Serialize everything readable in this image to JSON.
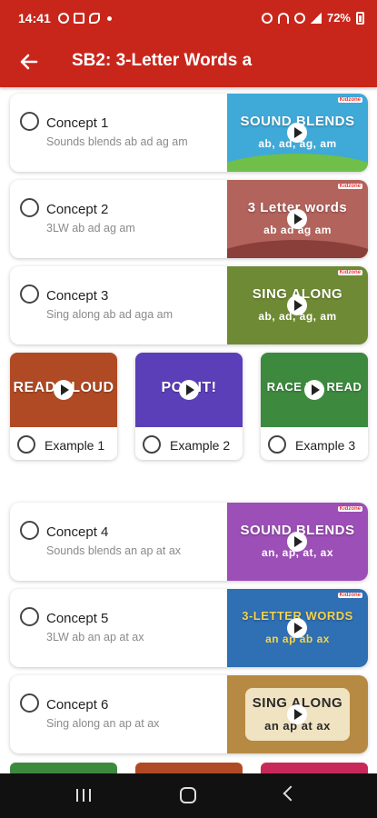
{
  "status": {
    "time": "14:41",
    "battery": "72%",
    "bar_color": "#c9261b"
  },
  "appbar": {
    "title": "SB2: 3-Letter Words a",
    "back_icon": "arrow-left-icon"
  },
  "concepts": [
    {
      "title": "Concept 1",
      "subtitle": "Sounds blends ab ad ag am",
      "thumb_line1": "SOUND BLENDS",
      "thumb_line2": "ab, ad, ag, am",
      "thumb_color": "#3fa9d8"
    },
    {
      "title": "Concept 2",
      "subtitle": "3LW ab ad ag am",
      "thumb_line1": "3 Letter words",
      "thumb_line2": "ab ad ag am",
      "thumb_color": "#b2635c"
    },
    {
      "title": "Concept 3",
      "subtitle": "Sing along ab ad aga am",
      "thumb_line1": "SING ALONG",
      "thumb_line2": "ab, ad, ag, am",
      "thumb_color": "#6f8a34"
    },
    {
      "title": "Concept 4",
      "subtitle": "Sounds blends an ap at ax",
      "thumb_line1": "SOUND BLENDS",
      "thumb_line2": "an, ap, at, ax",
      "thumb_color": "#9c4fb6"
    },
    {
      "title": "Concept 5",
      "subtitle": "3LW ab an ap at ax",
      "thumb_line1": "3-LETTER WORDS",
      "thumb_line2": "an ap ab ax",
      "thumb_color": "#2f6fb3"
    },
    {
      "title": "Concept 6",
      "subtitle": "Sing along an ap at ax",
      "thumb_line1": "SING ALONG",
      "thumb_line2": "an ap at ax",
      "thumb_color": "#b78a43"
    }
  ],
  "examples": [
    {
      "label": "Example 1",
      "thumb_text": "READ ALOUD",
      "thumb_color": "#b04a24"
    },
    {
      "label": "Example 2",
      "thumb_text": "POP IT!",
      "thumb_color": "#5b3fb8"
    },
    {
      "label": "Example 3",
      "thumb_text": "RACE TO READ",
      "thumb_color": "#3d8a3f"
    }
  ],
  "brand_label": "Kidzone",
  "icons": {
    "play": "play-icon",
    "radio": "radio-unchecked-icon"
  }
}
